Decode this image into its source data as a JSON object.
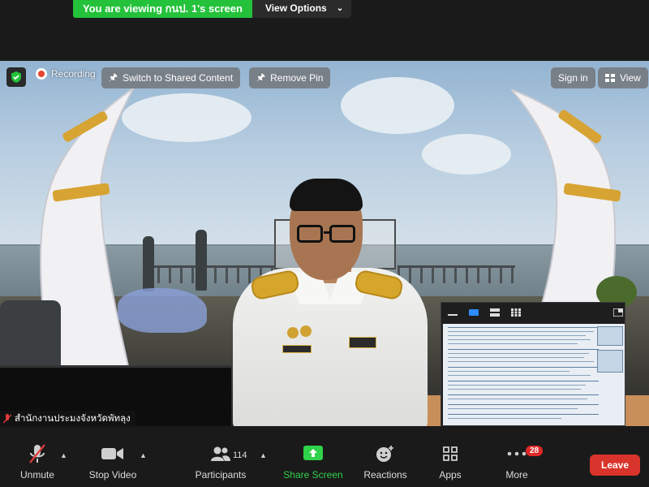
{
  "banner": {
    "viewing_text": "You are viewing กนป. 1's screen",
    "view_options": "View Options"
  },
  "meeting_top": {
    "recording_label": "Recording",
    "switch_label": "Switch to Shared Content",
    "remove_pin_label": "Remove Pin",
    "sign_in_label": "Sign in",
    "view_label": "View"
  },
  "participant": {
    "name": "สำนักงานประมงจังหวัดพัทลุง"
  },
  "controls": {
    "unmute": "Unmute",
    "stop_video": "Stop Video",
    "participants": "Participants",
    "participants_count": "114",
    "share_screen": "Share Screen",
    "reactions": "Reactions",
    "apps": "Apps",
    "more": "More",
    "more_badge": "28",
    "leave": "Leave"
  },
  "colors": {
    "share_green": "#23c23a",
    "leave_red": "#d9342b",
    "badge_red": "#e02828"
  }
}
